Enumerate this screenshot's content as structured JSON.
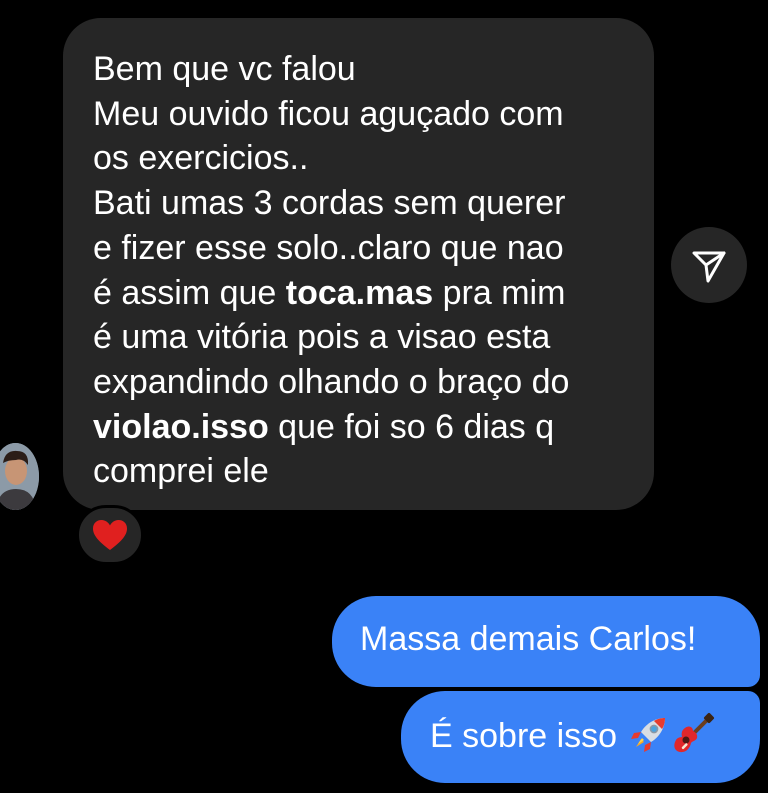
{
  "incoming_message": {
    "lines": [
      [
        {
          "t": "Bem que vc falou",
          "b": false
        }
      ],
      [
        {
          "t": "Meu ouvido ficou aguçado com",
          "b": false
        }
      ],
      [
        {
          "t": "os exercicios..",
          "b": false
        }
      ],
      [
        {
          "t": "Bati umas 3 cordas sem querer",
          "b": false
        }
      ],
      [
        {
          "t": "e fizer esse solo..claro que nao",
          "b": false
        }
      ],
      [
        {
          "t": "é assim que ",
          "b": false
        },
        {
          "t": "toca.mas",
          "b": true
        },
        {
          "t": " pra mim",
          "b": false
        }
      ],
      [
        {
          "t": "é uma vitória pois a visao esta",
          "b": false
        }
      ],
      [
        {
          "t": "expandindo olhando o braço do",
          "b": false
        }
      ],
      [
        {
          "t": "violao.isso",
          "b": true
        },
        {
          "t": " que foi so 6 dias q",
          "b": false
        }
      ],
      [
        {
          "t": "comprei ele",
          "b": false
        }
      ]
    ],
    "reaction": "heart"
  },
  "outgoing_messages": {
    "first": "Massa demais Carlos!",
    "second": "É sobre isso",
    "second_emojis": [
      "rocket",
      "guitar"
    ]
  },
  "colors": {
    "background": "#000000",
    "incoming_bubble": "#262626",
    "outgoing_bubble": "#3a82f7",
    "text": "#ffffff",
    "heart": "#e0201f"
  },
  "icons": {
    "share": "paper-plane-icon",
    "avatar": "contact-avatar"
  }
}
